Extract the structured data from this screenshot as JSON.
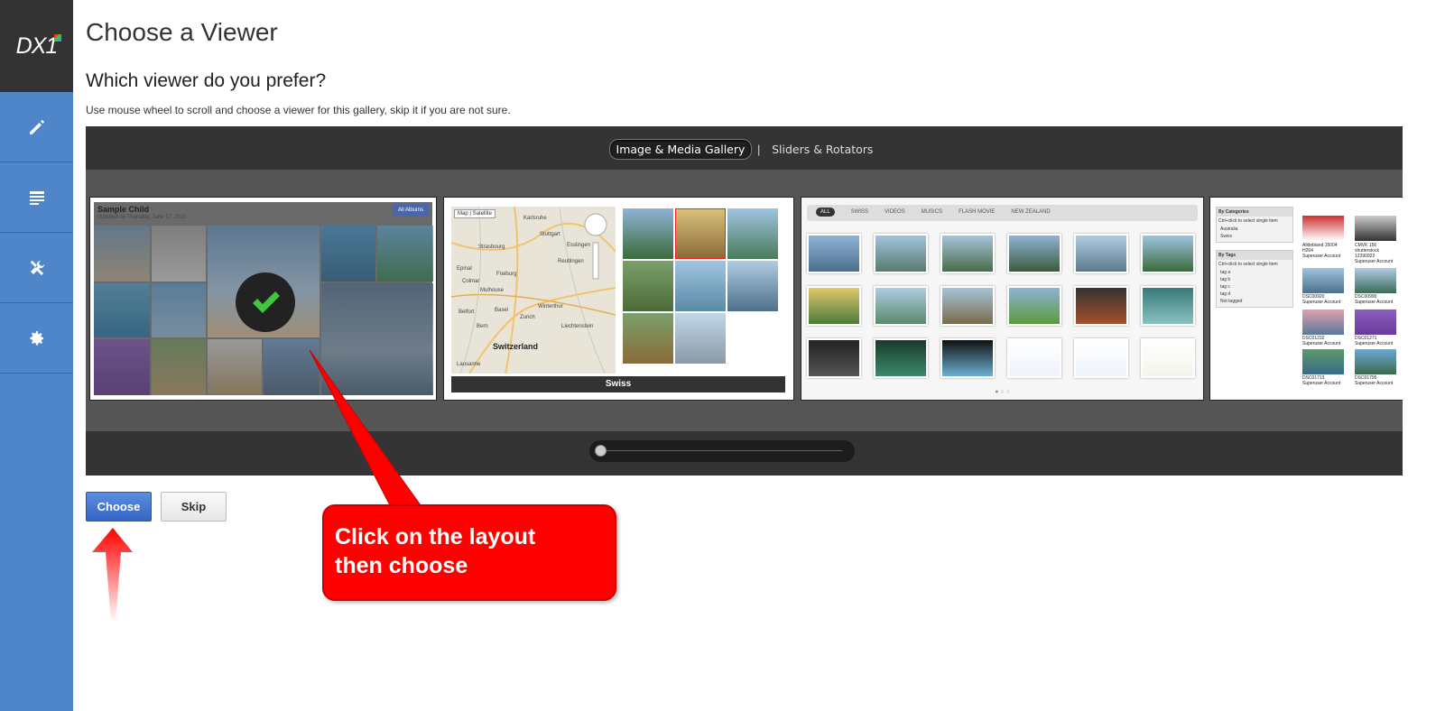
{
  "sidebar": {
    "logo_text": "DX1",
    "items": [
      {
        "name": "pencil-icon"
      },
      {
        "name": "list-icon"
      },
      {
        "name": "tools-icon"
      },
      {
        "name": "gear-icon"
      }
    ]
  },
  "page": {
    "title": "Choose a Viewer",
    "question": "Which viewer do you prefer?",
    "hint": "Use mouse wheel to scroll and choose a viewer for this gallery, skip it if you are not sure."
  },
  "carousel": {
    "tabs": [
      {
        "label": "Image & Media Gallery",
        "active": true
      },
      {
        "label": "Sliders & Rotators",
        "active": false
      }
    ],
    "separator": "|",
    "slider_position": 0.0
  },
  "card1": {
    "title": "Sample Child",
    "subtitle": "Updated on Thursday, June 17, 2010",
    "all_albums": "All Albums"
  },
  "card2": {
    "map_btn": "Map",
    "satellite_btn": "Satellite",
    "country": "Switzerland",
    "cities": [
      "Karlsruhe",
      "Stuttgart",
      "Strasbourg",
      "Esslingen",
      "Freiburg",
      "Mulhouse",
      "Basel",
      "Zurich",
      "Winterthur",
      "Liechtenstein",
      "Bern",
      "Epinal",
      "Colmar",
      "Belfort",
      "Lausanne",
      "Reutlingen"
    ],
    "bar_label": "Swiss"
  },
  "card3": {
    "menu": [
      "ALL",
      "SWISS",
      "VIDEOS",
      "MUSICS",
      "FLASH MOVIE",
      "NEW ZEALAND"
    ],
    "dots": "● ○ ○"
  },
  "card4": {
    "panel1_title": "By Categories",
    "panel1_hint": "Ctrl+click to select single item",
    "panel1_items": [
      "Australia",
      "Swiss"
    ],
    "panel2_title": "By Tags",
    "panel2_hint": "Ctrl+click to select single item",
    "panel2_items": [
      "tag a",
      "tag b",
      "tag c",
      "tag d",
      "Not tagged"
    ],
    "captions": [
      "Alldebland 15004 H264",
      "Superuser Account",
      "CMVK 156 shutterstock 12390922",
      "Superuser Account",
      "DSC00920",
      "Superuser Account",
      "DSC00990",
      "Superuser Account",
      "DSC01232",
      "Superuser Account",
      "DSC01271",
      "Superuser Account",
      "DSC01713",
      "Superuser Account",
      "DSC01795",
      "Superuser Account"
    ]
  },
  "buttons": {
    "choose": "Choose",
    "skip": "Skip"
  },
  "callout": {
    "line1": "Click on the layout",
    "line2": "then choose"
  },
  "colors": {
    "sidebar": "#4f86c9",
    "logo_bg": "#333333",
    "callout": "#ff0000",
    "choose_button": "#3f73d0"
  }
}
